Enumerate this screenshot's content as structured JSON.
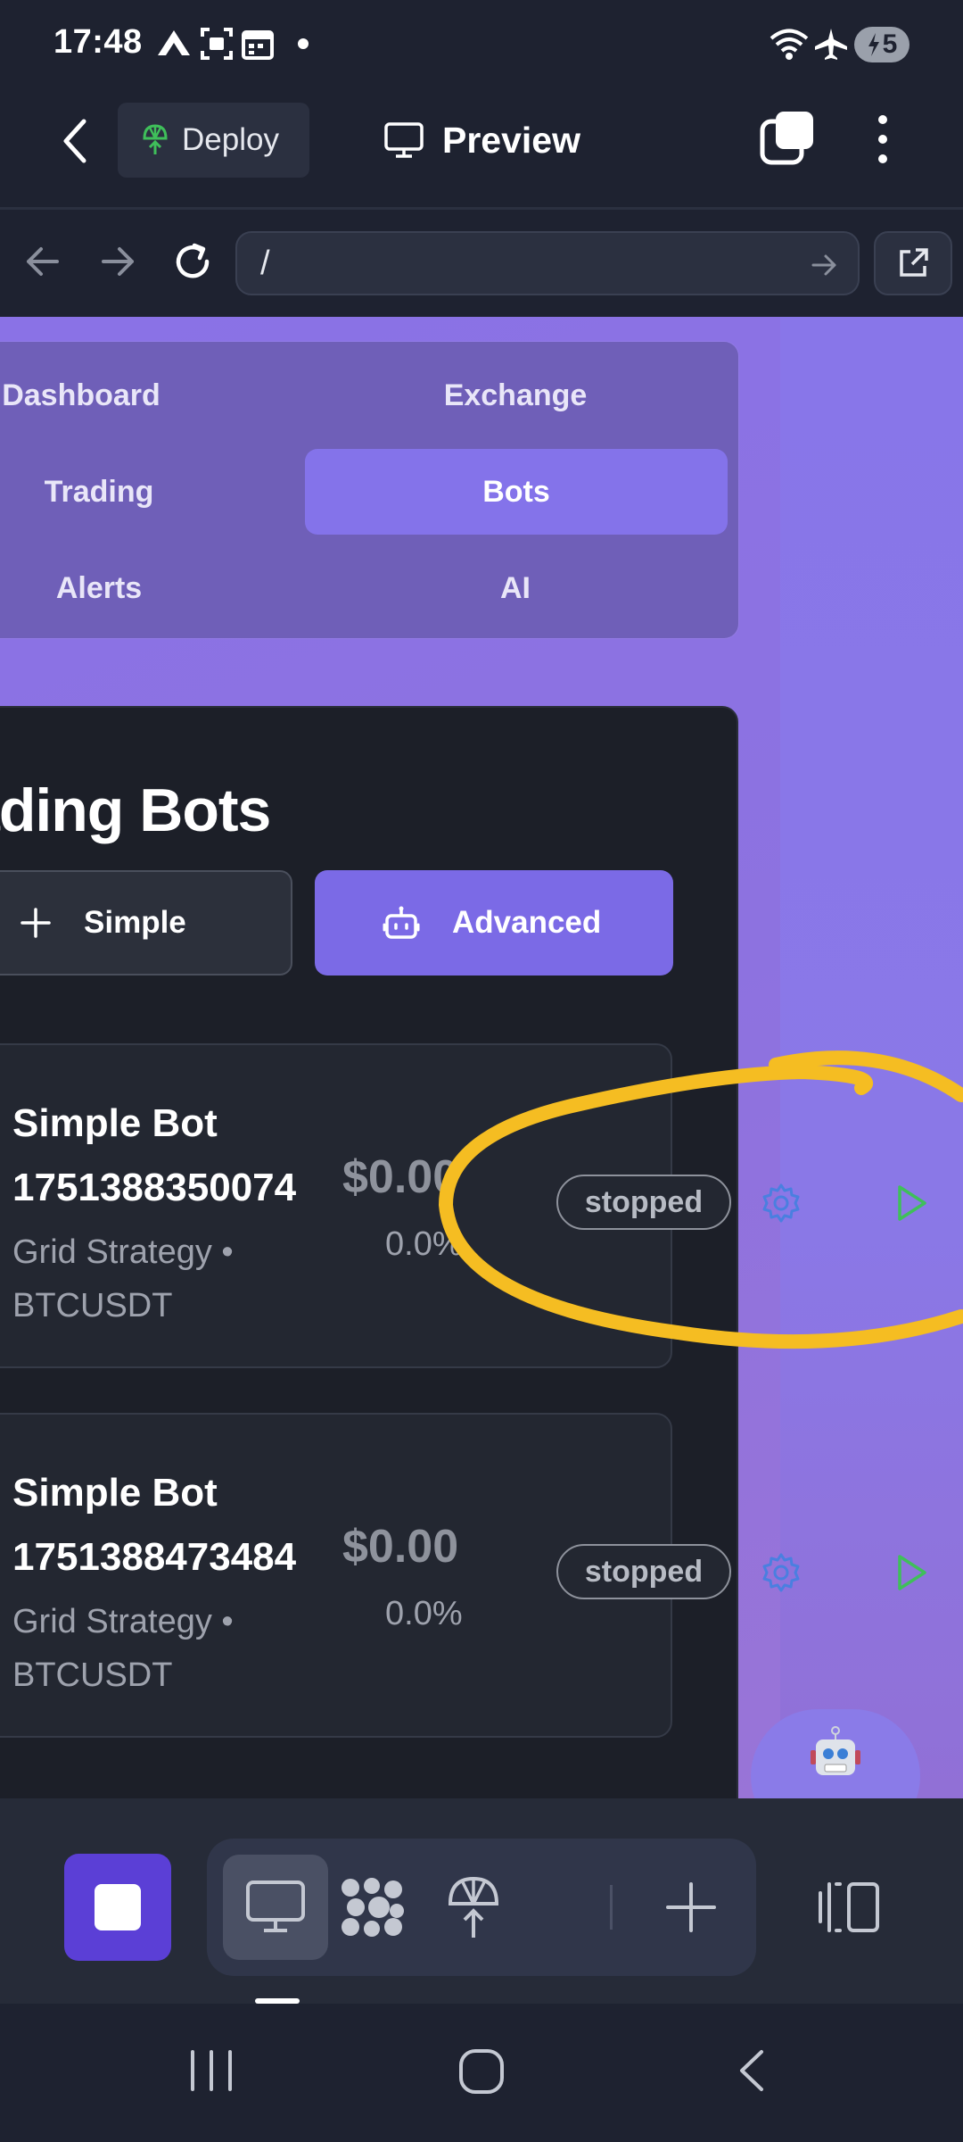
{
  "status_bar": {
    "time": "17:48",
    "battery_level": "5",
    "icons": [
      "wifi-icon",
      "airplane-icon",
      "battery-charging-icon",
      "a-icon",
      "screenshot-icon",
      "calendar-icon",
      "dot-icon"
    ]
  },
  "toolbar": {
    "deploy_label": "Deploy",
    "preview_label": "Preview"
  },
  "address_bar": {
    "url": "/"
  },
  "nav": {
    "items": [
      {
        "label": "Dashboard",
        "active": false
      },
      {
        "label": "Exchange",
        "active": false
      },
      {
        "label": "Trading",
        "active": false
      },
      {
        "label": "Bots",
        "active": true
      },
      {
        "label": "Alerts",
        "active": false
      },
      {
        "label": "AI",
        "active": false
      }
    ]
  },
  "page": {
    "heading": "ading Bots",
    "simple_label": "Simple",
    "advanced_label": "Advanced"
  },
  "bots": [
    {
      "name_line1": "Simple Bot",
      "name_line2": "1751388350074",
      "value": "$0.00",
      "strategy": "Grid Strategy •",
      "pair": "BTCUSDT",
      "change": "0.0%",
      "status": "stopped"
    },
    {
      "name_line1": "Simple Bot",
      "name_line2": "1751388473484",
      "value": "$0.00",
      "strategy": "Grid Strategy •",
      "pair": "BTCUSDT",
      "change": "0.0%",
      "status": "stopped"
    }
  ],
  "colors": {
    "accent": "#7b6ae6",
    "background": "#1e2230",
    "annotation": "#f5bd22",
    "play_green": "#3fbf5a",
    "gear_blue": "#4a7fe0"
  }
}
